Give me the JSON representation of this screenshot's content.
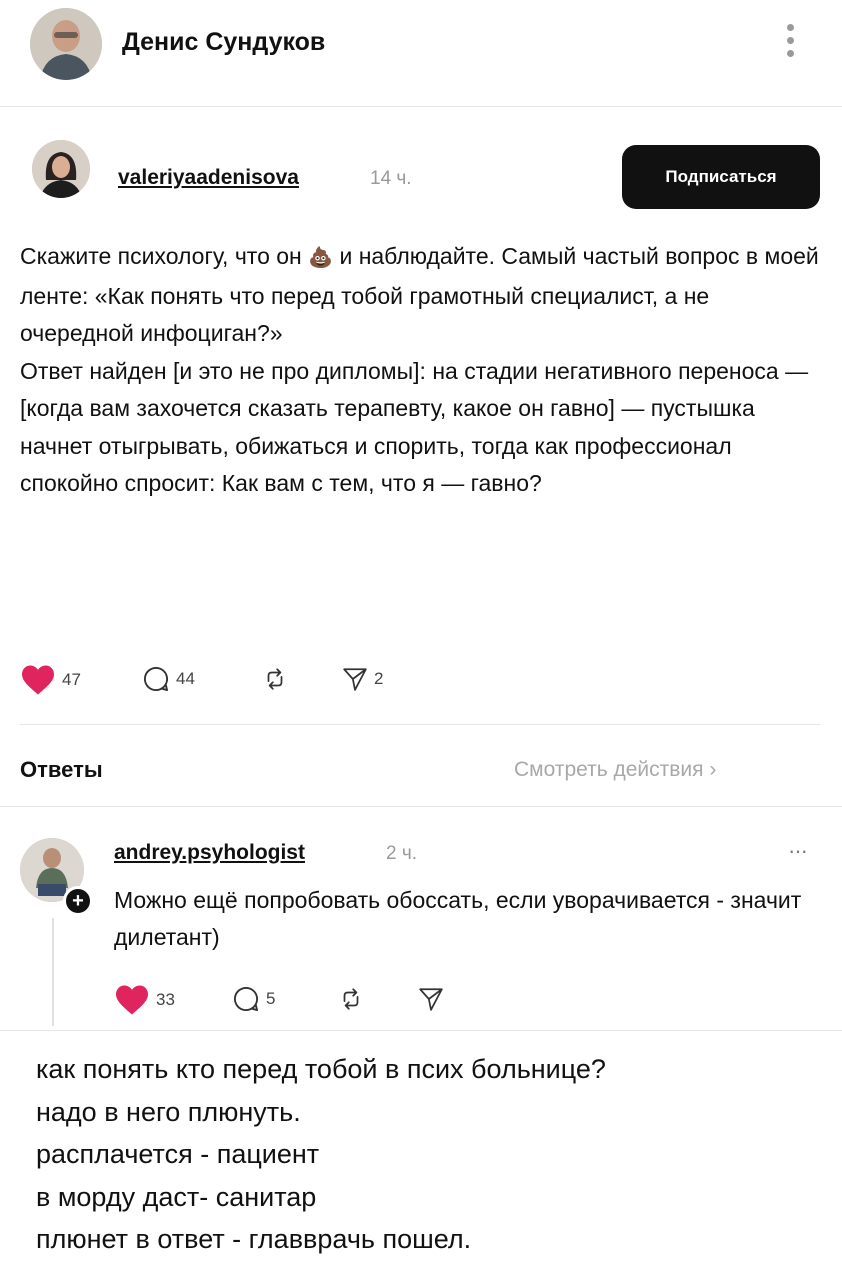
{
  "header": {
    "name": "Денис Сундуков"
  },
  "post": {
    "username": "valeriyaadenisova",
    "time": "14 ч.",
    "follow_label": "Подписаться",
    "text_before_emoji": "Скажите психологу, что он ",
    "emoji": "💩",
    "text_after_emoji": " и наблюдайте. Самый частый вопрос в моей ленте: «Как понять что перед тобой грамотный специалист, а не очередной инфоциган?»",
    "paragraph2": "Ответ найден [и это не про дипломы]: на стадии негативного переноса — [когда вам захочется сказать терапевту, какое он гавно] — пустышка начнет отыгрывать, обижаться и спорить, тогда как профессионал спокойно спросит: Как вам с тем, что я — гавно?",
    "likes": "47",
    "comments": "44",
    "shares": "2"
  },
  "replies_section": {
    "label": "Ответы",
    "view_activity": "Смотреть действия ›"
  },
  "reply": {
    "username": "andrey.psyhologist",
    "time": "2 ч.",
    "more": "···",
    "text": "Можно ещё попробовать обоссать, если уворачивается - значит дилетант)",
    "likes": "33",
    "comments": "5"
  },
  "caption": {
    "lines": [
      "как понять кто перед тобой в псих больнице?",
      "надо в него плюнуть.",
      "расплачется - пациент",
      "в морду даст- санитар",
      "плюнет в ответ - главврачь пошел."
    ]
  },
  "colors": {
    "heart": "#e0245e",
    "follow_bg": "#111111",
    "muted": "#9a9a9a"
  }
}
